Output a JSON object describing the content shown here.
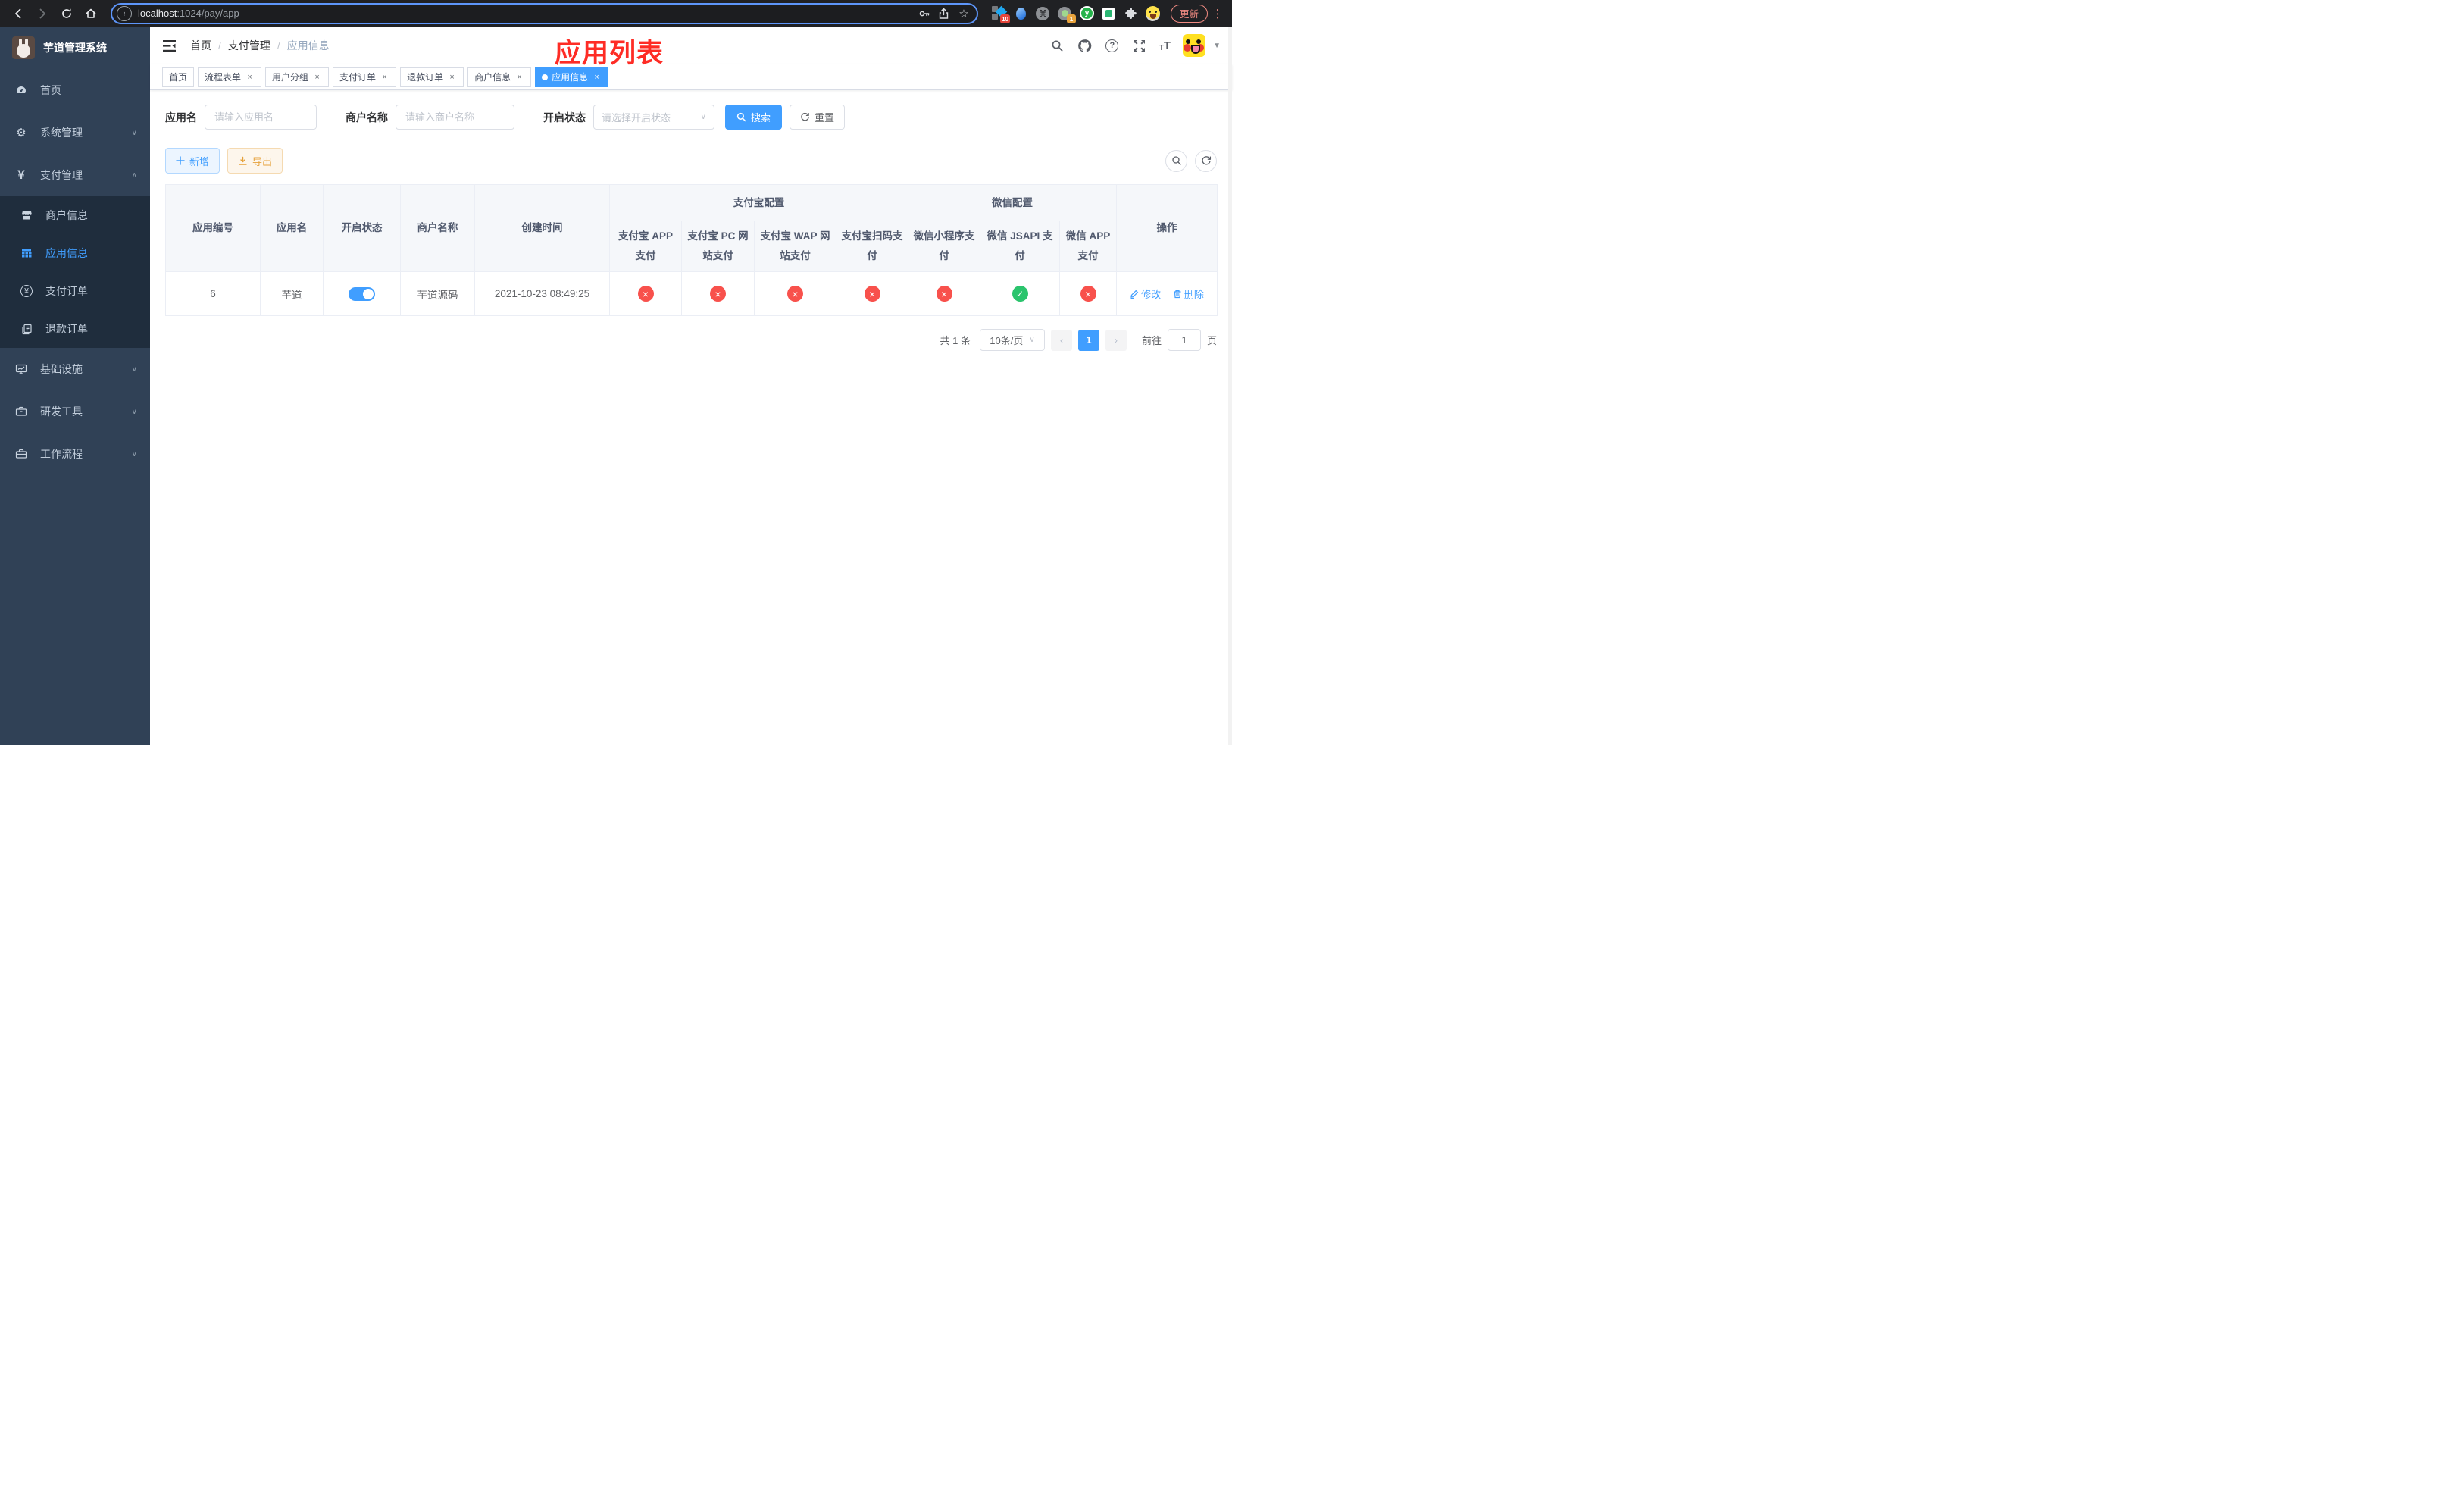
{
  "browser": {
    "url_host": "localhost",
    "url_rest": ":1024/pay/app",
    "update_label": "更新",
    "ext_badge_count": "10",
    "ext_badge_count2": "1",
    "ext_y_letter": "y",
    "cmd_glyph": "⌘",
    "info_glyph": "i"
  },
  "sidebar": {
    "title": "芋道管理系统",
    "items": [
      {
        "label": "首页"
      },
      {
        "label": "系统管理"
      },
      {
        "label": "支付管理"
      },
      {
        "label": "商户信息"
      },
      {
        "label": "应用信息"
      },
      {
        "label": "支付订单"
      },
      {
        "label": "退款订单"
      },
      {
        "label": "基础设施"
      },
      {
        "label": "研发工具"
      },
      {
        "label": "工作流程"
      }
    ],
    "yen_glyph": "¥",
    "gear_glyph": "⚙"
  },
  "navbar": {
    "breadcrumb": [
      "首页",
      "支付管理",
      "应用信息"
    ],
    "breadcrumb_sep": "/",
    "annotation": "应用列表",
    "question_glyph": "?",
    "font_small": "T",
    "font_large": "T"
  },
  "tags": [
    {
      "label": "首页"
    },
    {
      "label": "流程表单"
    },
    {
      "label": "用户分组"
    },
    {
      "label": "支付订单"
    },
    {
      "label": "退款订单"
    },
    {
      "label": "商户信息"
    },
    {
      "label": "应用信息"
    }
  ],
  "filters": {
    "app_name_label": "应用名",
    "app_name_placeholder": "请输入应用名",
    "merchant_label": "商户名称",
    "merchant_placeholder": "请输入商户名称",
    "status_label": "开启状态",
    "status_placeholder": "请选择开启状态",
    "search_label": "搜索",
    "reset_label": "重置"
  },
  "toolbar": {
    "add_label": "新增",
    "export_label": "导出"
  },
  "table": {
    "columns": {
      "id": "应用编号",
      "name": "应用名",
      "status": "开启状态",
      "merchant": "商户名称",
      "created": "创建时间",
      "op": "操作"
    },
    "group_headers": {
      "alipay": "支付宝配置",
      "wechat": "微信配置"
    },
    "sub_columns": [
      "支付宝 APP 支付",
      "支付宝 PC 网站支付",
      "支付宝 WAP 网站支付",
      "支付宝扫码支付",
      "微信小程序支付",
      "微信 JSAPI 支付",
      "微信 APP 支付"
    ],
    "row": {
      "id": "6",
      "name": "芋道",
      "status_on": true,
      "merchant": "芋道源码",
      "created": "2021-10-23 08:49:25",
      "pay_status": [
        "fail",
        "fail",
        "fail",
        "fail",
        "fail",
        "success",
        "fail"
      ],
      "edit_label": "修改",
      "delete_label": "删除"
    }
  },
  "pagination": {
    "total": "共 1 条",
    "page_size": "10条/页",
    "current_page": "1",
    "goto_label": "前往",
    "goto_value": "1",
    "goto_unit": "页"
  },
  "colors": {
    "accent": "#409eff",
    "danger": "#f8514c",
    "success": "#2bc46d",
    "warning": "#e6a23c",
    "annotation_red": "#fe2c25",
    "sidebar_bg": "#304156",
    "submenu_bg": "#1f2d3d",
    "chrome_bg": "#202124"
  }
}
